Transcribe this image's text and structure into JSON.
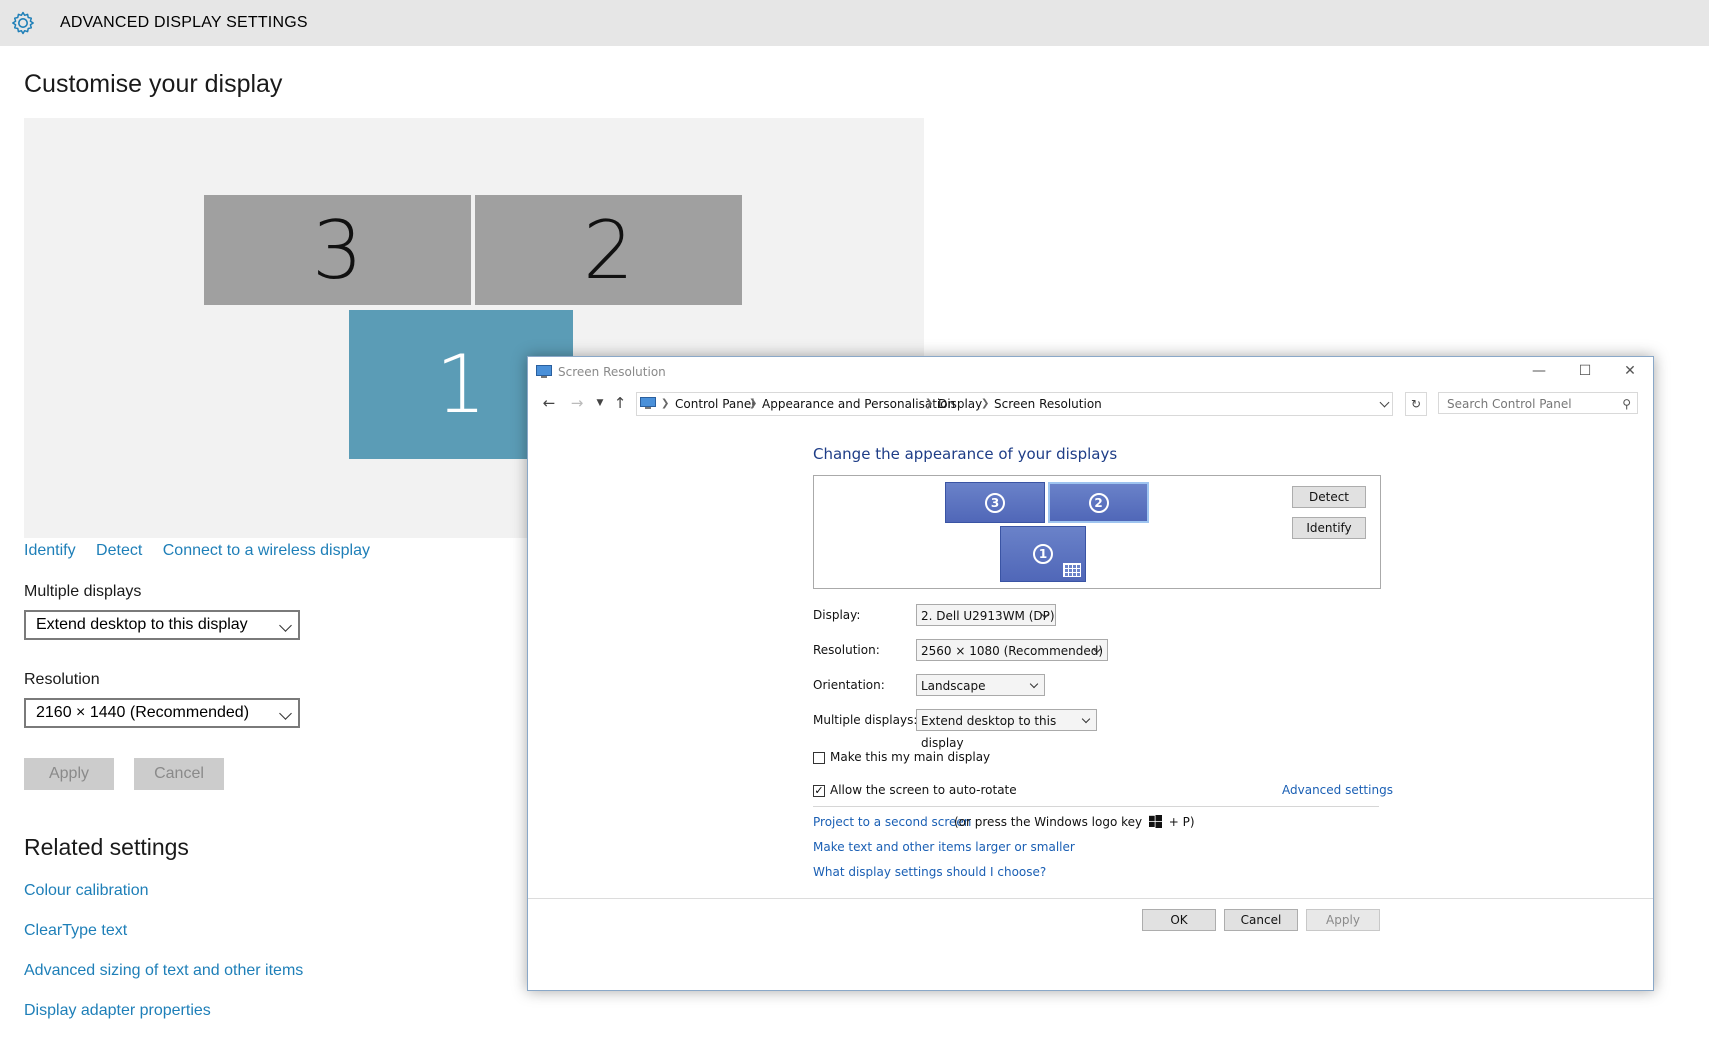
{
  "settings": {
    "title": "ADVANCED DISPLAY SETTINGS",
    "heading": "Customise your display",
    "monitors": [
      "3",
      "2",
      "1"
    ],
    "links": [
      "Identify",
      "Detect",
      "Connect to a wireless display"
    ],
    "multiple_displays_label": "Multiple displays",
    "multiple_displays_value": "Extend desktop to this display",
    "resolution_label": "Resolution",
    "resolution_value": "2160 × 1440 (Recommended)",
    "apply_label": "Apply",
    "cancel_label": "Cancel",
    "related_heading": "Related settings",
    "related_links": [
      "Colour calibration",
      "ClearType text",
      "Advanced sizing of text and other items",
      "Display adapter properties"
    ],
    "accent_color": "#1e7fb8",
    "selected_monitor_color": "#5b9cb6"
  },
  "control_panel": {
    "window_title": "Screen Resolution",
    "breadcrumbs": [
      "Control Panel",
      "Appearance and Personalisation",
      "Display",
      "Screen Resolution"
    ],
    "search_placeholder": "Search Control Panel",
    "heading": "Change the appearance of your displays",
    "monitors": [
      "3",
      "2",
      "1"
    ],
    "detect_label": "Detect",
    "identify_label": "Identify",
    "display_label": "Display:",
    "display_value": "2. Dell U2913WM (DP)",
    "resolution_label": "Resolution:",
    "resolution_value": "2560 × 1080 (Recommended)",
    "orientation_label": "Orientation:",
    "orientation_value": "Landscape",
    "multiple_label": "Multiple displays:",
    "multiple_value": "Extend desktop to this display",
    "main_display_label": "Make this my main display",
    "main_display_checked": false,
    "auto_rotate_label": "Allow the screen to auto-rotate",
    "auto_rotate_checked": true,
    "advanced_settings": "Advanced settings",
    "project_link": "Project to a second screen",
    "project_text_before": "(or press the Windows logo key",
    "project_text_after": "+ P)",
    "text_size_link": "Make text and other items larger or smaller",
    "which_settings_link": "What display settings should I choose?",
    "ok_label": "OK",
    "cancel_label": "Cancel",
    "apply_label": "Apply",
    "link_color": "#1a5fb4"
  }
}
